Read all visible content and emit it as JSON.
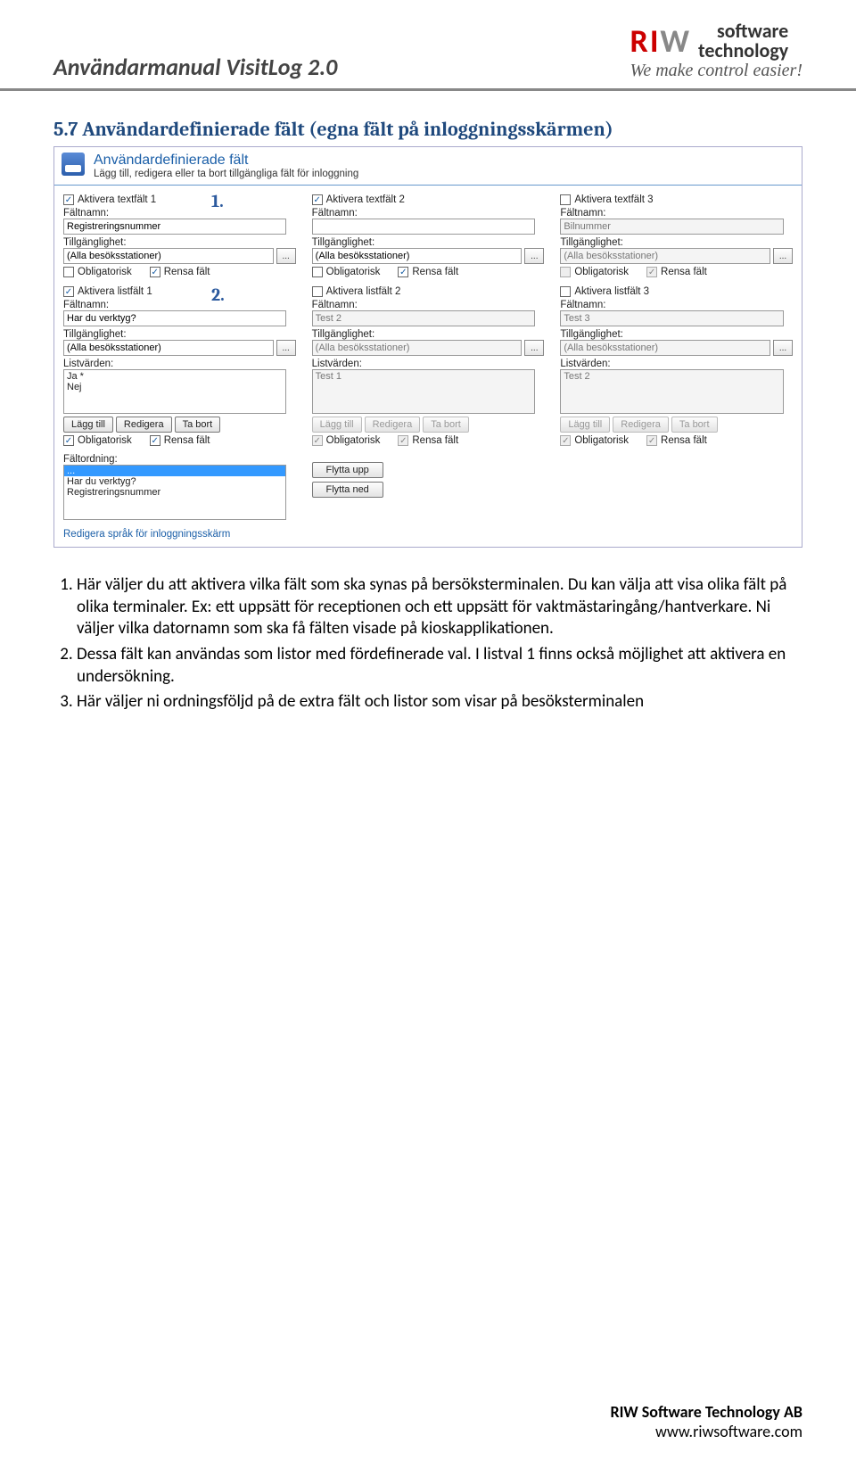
{
  "header": {
    "title": "Användarmanual VisitLog 2.0",
    "logo_software": "software",
    "logo_technology": "technology",
    "logo_slogan": "We make control easier!"
  },
  "section": {
    "heading": "5.7   Användardefinierade fält (egna fält på inloggningsskärmen)"
  },
  "panel": {
    "title": "Användardefinierade fält",
    "subtitle": "Lägg till, redigera eller ta bort tillgängliga fält för inloggning",
    "callout1": "1.",
    "callout2": "2.",
    "labels": {
      "faltnamn": "Fältnamn:",
      "tillganglighet": "Tillgänglighet:",
      "listvarden": "Listvärden:",
      "faltordning": "Fältordning:",
      "obligatorisk": "Obligatorisk",
      "rensa": "Rensa fält",
      "allabesok": "(Alla besöksstationer)",
      "dots": "...",
      "laggtill": "Lägg till",
      "redigera": "Redigera",
      "tabort": "Ta bort",
      "flyttaupp": "Flytta upp",
      "flyttaned": "Flytta ned"
    },
    "text1": {
      "act": "Aktivera textfält 1",
      "val": "Registreringsnummer"
    },
    "text2": {
      "act": "Aktivera textfält 2",
      "val": ""
    },
    "text3": {
      "act": "Aktivera textfält 3",
      "val": "Bilnummer"
    },
    "list1": {
      "act": "Aktivera listfält 1",
      "val": "Har du verktyg?",
      "items": "Ja *\nNej"
    },
    "list2": {
      "act": "Aktivera listfält 2",
      "val": "Test 2",
      "items": "Test 1"
    },
    "list3": {
      "act": "Aktivera listfält 3",
      "val": "Test 3",
      "items": "Test 2"
    },
    "order": {
      "sel": "...",
      "i1": "Har du verktyg?",
      "i2": "Registreringsnummer"
    },
    "link": "Redigera språk för inloggningsskärm"
  },
  "body": {
    "li1": "Här väljer du att aktivera vilka fält som ska synas på bersöksterminalen. Du kan välja att visa olika fält på olika terminaler. Ex: ett uppsätt för receptionen och ett uppsätt för vaktmästaringång/hantverkare. Ni väljer vilka datornamn som ska få fälten visade på kioskapplikationen.",
    "li2": " Dessa fält kan användas som listor med fördefinerade val. I listval 1 finns också möjlighet att aktivera en undersökning.",
    "li3": "Här väljer ni ordningsföljd på de extra fält och listor som visar på besöksterminalen"
  },
  "footer": {
    "company": "RIW Software Technology AB",
    "url": "www.riwsoftware.com"
  }
}
